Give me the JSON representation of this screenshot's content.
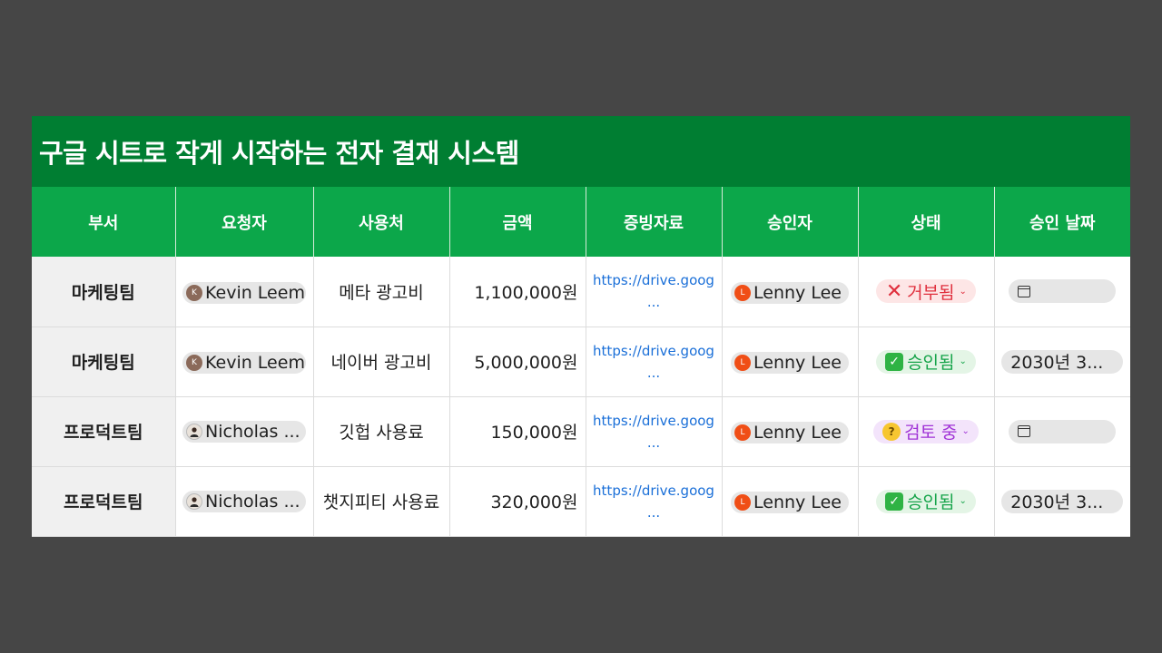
{
  "title": "구글 시트로 작게 시작하는 전자 결재 시스템",
  "columns": [
    "부서",
    "요청자",
    "사용처",
    "금액",
    "증빙자료",
    "승인자",
    "상태",
    "승인 날짜"
  ],
  "rows": [
    {
      "dept": "마케팅팀",
      "requester": "Kevin Leem",
      "requester_initial": "K",
      "usage": "메타 광고비",
      "amount": "1,100,000원",
      "link_line1": "https://drive.goog",
      "link_line2": "...",
      "approver": "Lenny Lee",
      "approver_initial": "L",
      "status": "거부됨",
      "status_icon": "❌",
      "date": ""
    },
    {
      "dept": "마케팅팀",
      "requester": "Kevin Leem",
      "requester_initial": "K",
      "usage": "네이버 광고비",
      "amount": "5,000,000원",
      "link_line1": "https://drive.goog",
      "link_line2": "...",
      "approver": "Lenny Lee",
      "approver_initial": "L",
      "status": "승인됨",
      "status_icon": "✅",
      "date": "2030년 3..."
    },
    {
      "dept": "프로덕트팀",
      "requester": "Nicholas ...",
      "usage": "깃헙 사용료",
      "amount": "150,000원",
      "link_line1": "https://drive.goog",
      "link_line2": "...",
      "approver": "Lenny Lee",
      "approver_initial": "L",
      "status": "검토 중",
      "status_icon": "🤔",
      "date": ""
    },
    {
      "dept": "프로덕트팀",
      "requester": "Nicholas ...",
      "usage": "챗지피티 사용료",
      "amount": "320,000원",
      "link_line1": "https://drive.goog",
      "link_line2": "...",
      "approver": "Lenny Lee",
      "approver_initial": "L",
      "status": "승인됨",
      "status_icon": "✅",
      "date": "2030년 3..."
    }
  ],
  "colors": {
    "title_bg": "#007e32",
    "header_bg": "#0ca74a",
    "page_bg": "#464646",
    "rejected": "#e0303e",
    "approved": "#16a44a",
    "review": "#a032d6"
  }
}
